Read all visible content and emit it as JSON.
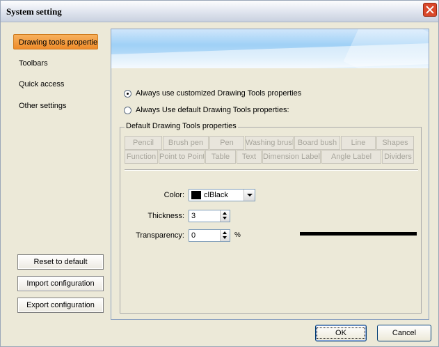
{
  "window": {
    "title": "System setting"
  },
  "sidebar": {
    "items": [
      {
        "label": "Drawing tools properties",
        "active": true
      },
      {
        "label": "Toolbars",
        "active": false
      },
      {
        "label": "Quick access",
        "active": false
      },
      {
        "label": "Other settings",
        "active": false
      }
    ],
    "buttons": {
      "reset": "Reset to default",
      "import": "Import configuration",
      "export": "Export configuration"
    }
  },
  "options": {
    "custom": "Always use customized Drawing Tools properties",
    "default": "Always Use default Drawing Tools properties:",
    "selected": "custom"
  },
  "group": {
    "title": "Default Drawing Tools properties",
    "tools_row1": [
      "Pencil",
      "Brush pen",
      "Pen",
      "Washing brush",
      "Board bush",
      "Line",
      "Shapes"
    ],
    "tools_row2": [
      "Function",
      "Point to Point",
      "Table",
      "Text",
      "Dimension Label",
      "Angle Label",
      "Dividers"
    ]
  },
  "properties": {
    "color_label": "Color:",
    "color_value": "clBlack",
    "color_swatch": "#000000",
    "thickness_label": "Thickness:",
    "thickness_value": "3",
    "transparency_label": "Transparency:",
    "transparency_value": "0",
    "transparency_unit": "%"
  },
  "footer": {
    "ok": "OK",
    "cancel": "Cancel"
  },
  "colors": {
    "accent": "#ee8b2a",
    "banner": "#9fd0f6",
    "close": "#d9482b"
  }
}
